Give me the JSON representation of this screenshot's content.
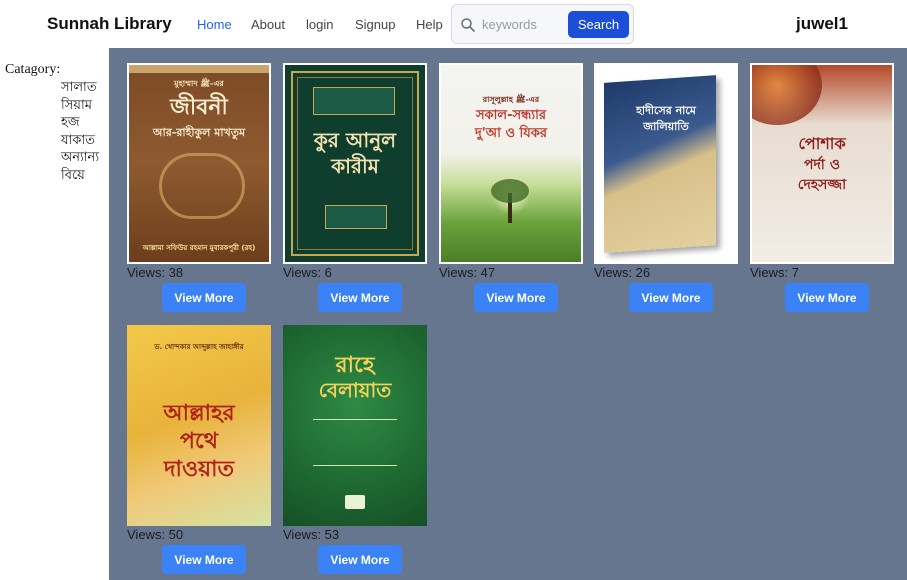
{
  "nav": {
    "brand": "Sunnah Library",
    "links": [
      "Home",
      "About",
      "login",
      "Signup",
      "Help"
    ],
    "active_link": "Home",
    "search_placeholder": "keywords",
    "search_button": "Search",
    "username": "juwel1"
  },
  "sidebar": {
    "title": "Catagory:",
    "categories": [
      "সালাত",
      "সিয়াম",
      "হজ",
      "যাকাত",
      "অন্যান্য",
      "বিয়ে"
    ]
  },
  "books": [
    {
      "views": "Views: 38",
      "button": "View More",
      "cover_text": [
        "মুহাম্মাদ ﷺ-এর",
        "জীবনী",
        "আর-রাহীকুল মাখতুম",
        "আল্লামা সফিউর রহমান মুবারকপুরী (রহ)"
      ]
    },
    {
      "views": "Views: 6",
      "button": "View More",
      "cover_text": [
        "কুর আনুল",
        "কারীম"
      ]
    },
    {
      "views": "Views: 47",
      "button": "View More",
      "cover_text": [
        "রাসূলুল্লাহ ﷺ-এর",
        "সকাল-সন্ধ্যার",
        "দু'আ ও যিকর"
      ]
    },
    {
      "views": "Views: 26",
      "button": "View More",
      "cover_text": [
        "হাদীসের নামে",
        "জালিয়াতি"
      ]
    },
    {
      "views": "Views: 7",
      "button": "View More",
      "cover_text": [
        "পোশাক",
        "পর্দা ও",
        "দেহসজ্জা"
      ]
    },
    {
      "views": "Views: 50",
      "button": "View More",
      "cover_text": [
        "ড. খোন্দকার আব্দুল্লাহ জাহাঙ্গীর",
        "আল্লাহর",
        "পথে",
        "দাওয়াত"
      ]
    },
    {
      "views": "Views: 53",
      "button": "View More",
      "cover_text": [
        "রাহে",
        "বেলায়াত"
      ]
    }
  ],
  "colors": {
    "main_bg": "#67768f",
    "button_blue": "#3b82f6",
    "search_blue": "#1d4ed8",
    "active_link": "#2563eb"
  }
}
